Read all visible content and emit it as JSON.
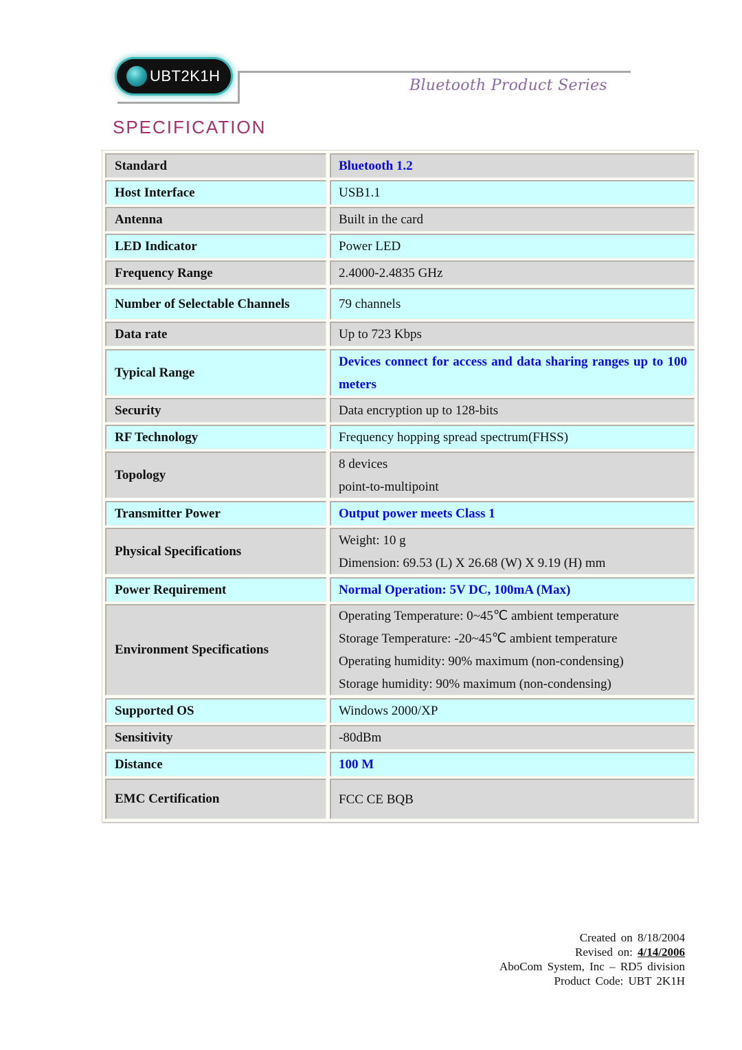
{
  "header": {
    "product_badge": "UBT2K1H",
    "series_title": "Bluetooth Product Series",
    "page_title": "SPECIFICATION"
  },
  "colors": {
    "title": "#a3306a",
    "series_title": "#8a6aa0",
    "highlight_text": "#0a0ae0",
    "row_gray": "#d9d9d9",
    "row_cyan": "#ccffff",
    "badge_glow": "#3bb7b7"
  },
  "spec": {
    "rows": [
      {
        "label": "Standard",
        "lines": [
          "Bluetooth 1.2"
        ],
        "highlight": true
      },
      {
        "label": "Host Interface",
        "lines": [
          "USB1.1"
        ]
      },
      {
        "label": "Antenna",
        "lines": [
          "Built in the card"
        ]
      },
      {
        "label": "LED Indicator",
        "lines": [
          "Power LED"
        ]
      },
      {
        "label": "Frequency Range",
        "lines": [
          "2.4000-2.4835 GHz"
        ]
      },
      {
        "label": "Number of Selectable Channels",
        "lines": [
          "79 channels"
        ]
      },
      {
        "label": "Data rate",
        "lines": [
          "Up to 723 Kbps"
        ]
      },
      {
        "label": "Typical Range",
        "lines": [
          "Devices connect for access and data sharing ranges up to 100 meters"
        ],
        "highlight": true
      },
      {
        "label": "Security",
        "lines": [
          "Data encryption up to 128-bits"
        ]
      },
      {
        "label": "RF Technology",
        "lines": [
          "Frequency hopping spread spectrum(FHSS)"
        ]
      },
      {
        "label": "Topology",
        "lines": [
          "8 devices",
          "point-to-multipoint"
        ]
      },
      {
        "label": "Transmitter Power",
        "lines": [
          "Output power meets Class 1"
        ],
        "highlight": true
      },
      {
        "label": "Physical Specifications",
        "lines": [
          "Weight: 10 g",
          "Dimension: 69.53 (L) X 26.68 (W) X 9.19 (H) mm"
        ]
      },
      {
        "label": "Power Requirement",
        "lines": [
          "Normal Operation: 5V DC, 100mA (Max)"
        ],
        "highlight": true
      },
      {
        "label": "Environment Specifications",
        "lines": [
          "Operating Temperature: 0~45℃  ambient temperature",
          "Storage Temperature: -20~45℃  ambient temperature",
          "Operating humidity: 90% maximum (non-condensing)",
          "Storage humidity: 90% maximum (non-condensing)"
        ]
      },
      {
        "label": "Supported OS",
        "lines": [
          "Windows 2000/XP"
        ]
      },
      {
        "label": "Sensitivity",
        "lines": [
          "-80dBm"
        ]
      },
      {
        "label": "Distance",
        "lines": [
          "100 M"
        ],
        "highlight": true
      },
      {
        "label": "EMC Certification",
        "lines": [
          "FCC CE BQB"
        ]
      }
    ]
  },
  "footer": {
    "created": "Created on 8/18/2004",
    "revised_label": "Revised on:",
    "revised_date": "4/14/2006",
    "company": "AboCom System, Inc – RD5 division",
    "product_code": "Product Code: UBT 2K1H"
  }
}
